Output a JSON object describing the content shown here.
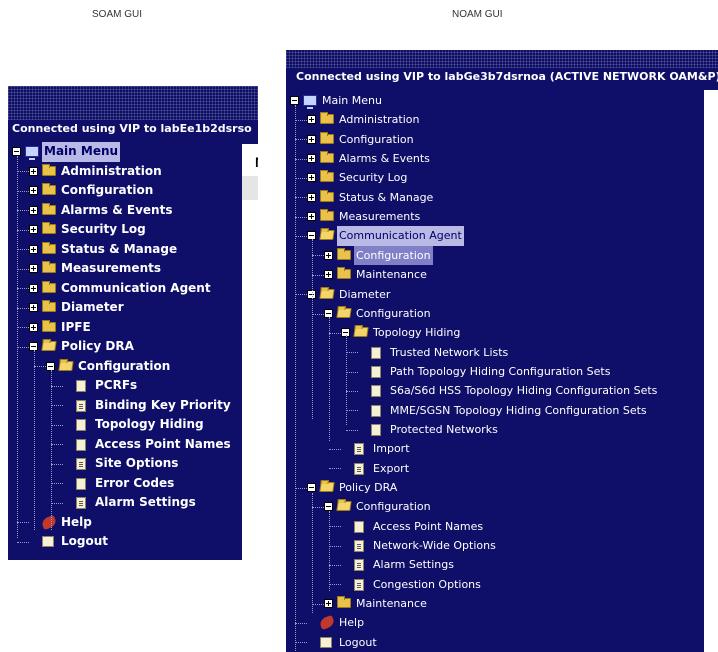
{
  "captions": {
    "soam": "SOAM GUI",
    "noam": "NOAM GUI"
  },
  "soam": {
    "connection": "Connected using VIP to labEe1b2dsrso",
    "right_fragment": "M",
    "items": [
      {
        "label": "Main Menu",
        "icon": "computer-icon",
        "level": 0,
        "exp": "minus"
      },
      {
        "label": "Administration",
        "icon": "folder-icon",
        "level": 1,
        "exp": "plus"
      },
      {
        "label": "Configuration",
        "icon": "folder-icon",
        "level": 1,
        "exp": "plus"
      },
      {
        "label": "Alarms & Events",
        "icon": "folder-icon",
        "level": 1,
        "exp": "plus"
      },
      {
        "label": "Security Log",
        "icon": "folder-icon",
        "level": 1,
        "exp": "plus"
      },
      {
        "label": "Status & Manage",
        "icon": "folder-icon",
        "level": 1,
        "exp": "plus"
      },
      {
        "label": "Measurements",
        "icon": "folder-icon",
        "level": 1,
        "exp": "plus"
      },
      {
        "label": "Communication Agent",
        "icon": "folder-icon",
        "level": 1,
        "exp": "plus"
      },
      {
        "label": "Diameter",
        "icon": "folder-icon",
        "level": 1,
        "exp": "plus"
      },
      {
        "label": "IPFE",
        "icon": "folder-icon",
        "level": 1,
        "exp": "plus"
      },
      {
        "label": "Policy DRA",
        "icon": "open-folder-icon",
        "level": 1,
        "exp": "minus"
      },
      {
        "label": "Configuration",
        "icon": "open-folder-icon",
        "level": 2,
        "exp": "minus"
      },
      {
        "label": "PCRFs",
        "icon": "page-icon",
        "level": 3
      },
      {
        "label": "Binding Key Priority",
        "icon": "lined-page-icon",
        "level": 3
      },
      {
        "label": "Topology Hiding",
        "icon": "page-icon",
        "level": 3
      },
      {
        "label": "Access Point Names",
        "icon": "page-icon",
        "level": 3
      },
      {
        "label": "Site Options",
        "icon": "lined-page-icon",
        "level": 3
      },
      {
        "label": "Error Codes",
        "icon": "page-icon",
        "level": 3
      },
      {
        "label": "Alarm Settings",
        "icon": "lined-page-icon",
        "level": 3
      },
      {
        "label": "Help",
        "icon": "help-icon",
        "level": 1
      },
      {
        "label": "Logout",
        "icon": "logout-icon",
        "level": 1
      }
    ]
  },
  "noam": {
    "connection": "Connected using VIP to labGe3b7dsrnoa (ACTIVE NETWORK OAM&P)",
    "items": [
      {
        "label": "Main Menu",
        "icon": "computer-icon",
        "level": 0,
        "exp": "minus"
      },
      {
        "label": "Administration",
        "icon": "folder-icon",
        "level": 1,
        "exp": "plus"
      },
      {
        "label": "Configuration",
        "icon": "folder-icon",
        "level": 1,
        "exp": "plus"
      },
      {
        "label": "Alarms & Events",
        "icon": "folder-icon",
        "level": 1,
        "exp": "plus"
      },
      {
        "label": "Security Log",
        "icon": "folder-icon",
        "level": 1,
        "exp": "plus"
      },
      {
        "label": "Status & Manage",
        "icon": "folder-icon",
        "level": 1,
        "exp": "plus"
      },
      {
        "label": "Measurements",
        "icon": "folder-icon",
        "level": 1,
        "exp": "plus"
      },
      {
        "label": "Communication Agent",
        "icon": "open-folder-icon",
        "level": 1,
        "exp": "minus",
        "sel": "light"
      },
      {
        "label": "Configuration",
        "icon": "folder-icon",
        "level": 2,
        "exp": "plus",
        "sel": "dark"
      },
      {
        "label": "Maintenance",
        "icon": "folder-icon",
        "level": 2,
        "exp": "plus"
      },
      {
        "label": "Diameter",
        "icon": "open-folder-icon",
        "level": 1,
        "exp": "minus"
      },
      {
        "label": "Configuration",
        "icon": "open-folder-icon",
        "level": 2,
        "exp": "minus"
      },
      {
        "label": "Topology Hiding",
        "icon": "open-folder-icon",
        "level": 3,
        "exp": "minus"
      },
      {
        "label": "Trusted Network Lists",
        "icon": "page-icon",
        "level": 4
      },
      {
        "label": "Path Topology Hiding Configuration Sets",
        "icon": "page-icon",
        "level": 4
      },
      {
        "label": "S6a/S6d HSS Topology Hiding Configuration Sets",
        "icon": "page-icon",
        "level": 4
      },
      {
        "label": "MME/SGSN Topology Hiding Configuration Sets",
        "icon": "page-icon",
        "level": 4
      },
      {
        "label": "Protected Networks",
        "icon": "page-icon",
        "level": 4
      },
      {
        "label": "Import",
        "icon": "lined-page-icon",
        "level": 3
      },
      {
        "label": "Export",
        "icon": "lined-page-icon",
        "level": 3
      },
      {
        "label": "Policy DRA",
        "icon": "open-folder-icon",
        "level": 1,
        "exp": "minus"
      },
      {
        "label": "Configuration",
        "icon": "open-folder-icon",
        "level": 2,
        "exp": "minus"
      },
      {
        "label": "Access Point Names",
        "icon": "page-icon",
        "level": 3
      },
      {
        "label": "Network-Wide Options",
        "icon": "lined-page-icon",
        "level": 3
      },
      {
        "label": "Alarm Settings",
        "icon": "lined-page-icon",
        "level": 3
      },
      {
        "label": "Congestion Options",
        "icon": "lined-page-icon",
        "level": 3
      },
      {
        "label": "Maintenance",
        "icon": "folder-icon",
        "level": 2,
        "exp": "plus"
      },
      {
        "label": "Help",
        "icon": "help-icon",
        "level": 1
      },
      {
        "label": "Logout",
        "icon": "logout-icon",
        "level": 1
      }
    ]
  }
}
